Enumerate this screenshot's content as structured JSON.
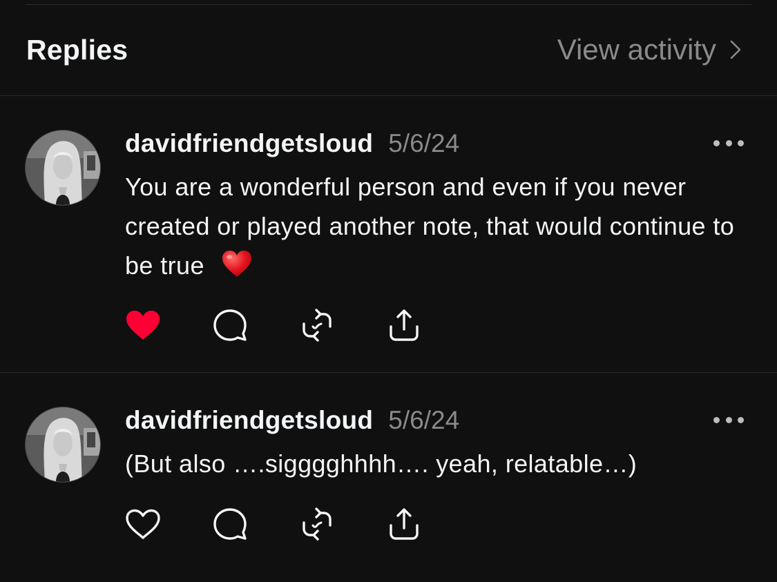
{
  "header": {
    "title": "Replies",
    "view_activity_label": "View activity"
  },
  "replies": [
    {
      "username": "davidfriendgetsloud",
      "date": "5/6/24",
      "text": "You are a wonderful person and even if you never created or played another note, that would continue to be true",
      "emoji": "red-heart",
      "liked": true
    },
    {
      "username": "davidfriendgetsloud",
      "date": "5/6/24",
      "text": "(But also ….sigggghhhh…. yeah, relatable…)",
      "liked": false
    }
  ],
  "icons": {
    "like": "heart-icon",
    "reply": "comment-icon",
    "repost": "repost-icon",
    "share": "share-icon",
    "more": "more-icon"
  },
  "colors": {
    "background": "#101010",
    "primary_text": "#f3f5f7",
    "secondary_text": "#8a8a8a",
    "liked_red": "#ff0034"
  }
}
